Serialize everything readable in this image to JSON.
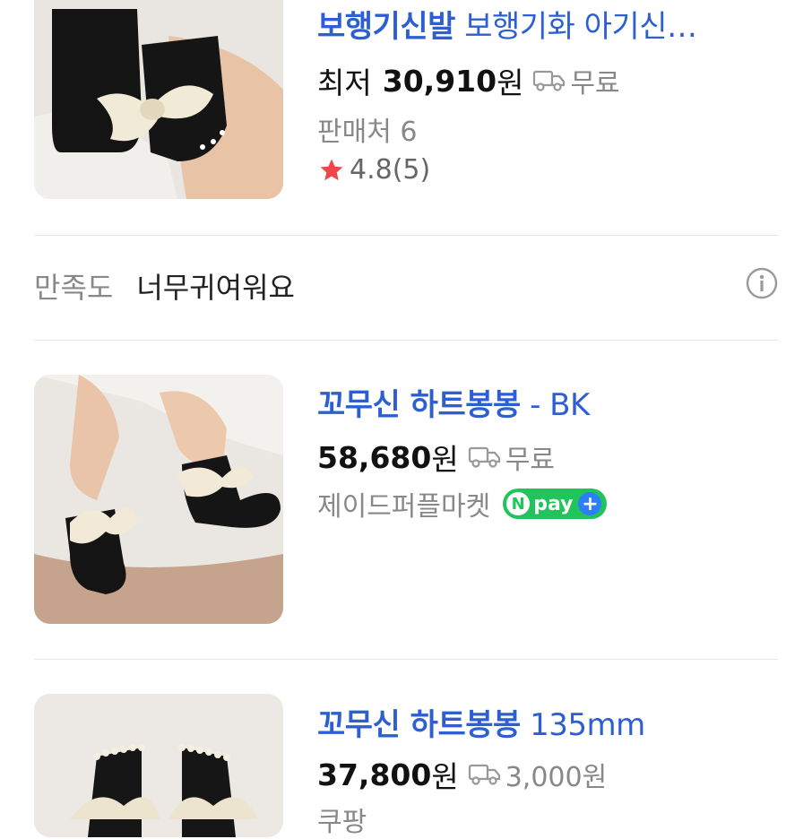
{
  "products": [
    {
      "title_bold": "보행기신발",
      "title_rest": " 보행기화 아기신…",
      "price_label": "최저",
      "price": "30,910",
      "price_unit": "원",
      "shipping": "무료",
      "sub_text": "판매처 6",
      "rating": "4.8",
      "review_count": "(5)"
    },
    {
      "title_bold": "꼬무신 하트봉봉",
      "title_rest": " - BK",
      "price": "58,680",
      "price_unit": "원",
      "shipping": "무료",
      "seller": "제이드퍼플마켓",
      "npay_text": "pay"
    },
    {
      "title_bold": "꼬무신 하트봉봉",
      "title_rest": " 135mm",
      "price": "37,800",
      "price_unit": "원",
      "shipping": "3,000원",
      "seller_partial": "쿠팡"
    }
  ],
  "satisfaction": {
    "label": "만족도",
    "value": "너무귀여워요"
  },
  "colors": {
    "title_blue": "#2d5fd2",
    "star_red": "#f0454c",
    "npay_green": "#21c45a",
    "npay_plus_blue": "#2d7ef7"
  },
  "icons": {
    "shipping": "truck-icon",
    "info": "info-icon",
    "rating": "star-icon"
  }
}
